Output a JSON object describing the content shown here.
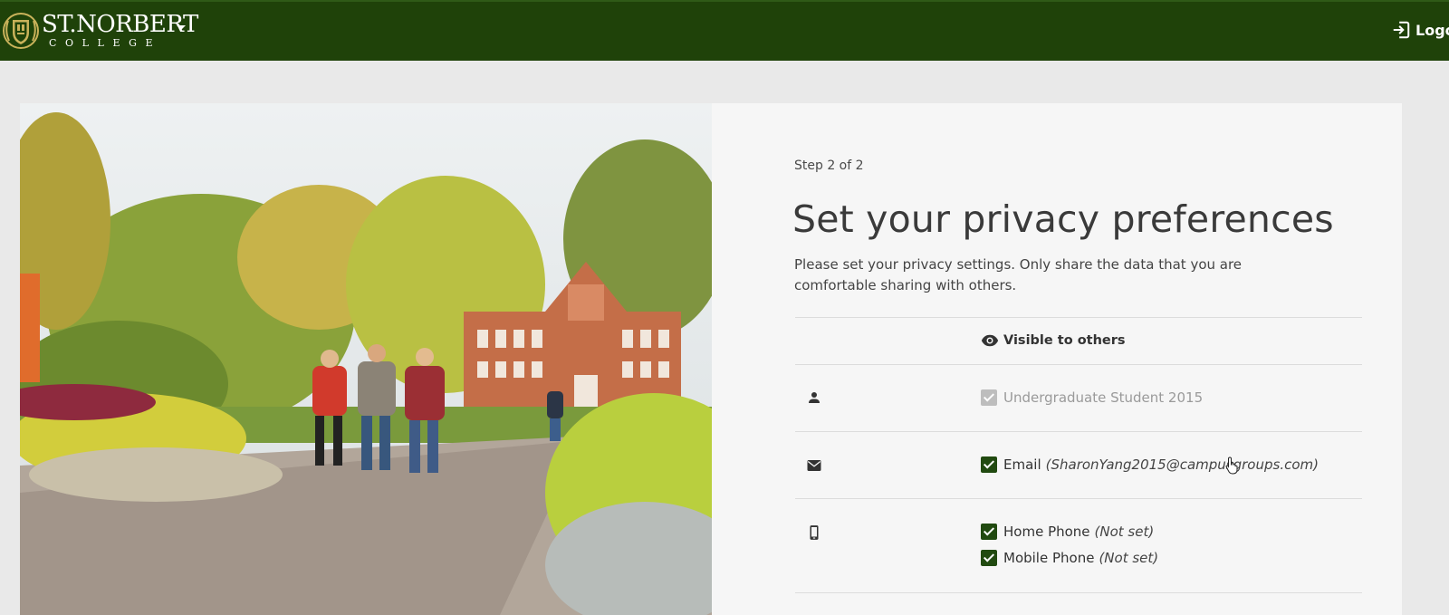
{
  "header": {
    "brand_top": "ST.NORBERT",
    "brand_bottom": "COLLEGE",
    "logout_label": "Logo",
    "colors": {
      "bar": "#1f4209",
      "accent": "#214a10"
    }
  },
  "icons": {
    "logout": "logout-icon",
    "visibility": "eye-icon",
    "user": "person-icon",
    "email": "envelope-icon",
    "phone": "mobile-phone-icon"
  },
  "privacy": {
    "step": "Step 2 of 2",
    "title": "Set your privacy preferences",
    "description": "Please set your privacy settings. Only share the data that you are comfortable sharing with others.",
    "column_header": "Visible to others",
    "options": {
      "student": {
        "label": "Undergraduate Student 2015",
        "checked": true,
        "disabled": true
      },
      "email": {
        "label": "Email",
        "value": "(SharonYang2015@campusgroups.com)",
        "checked": true
      },
      "home_phone": {
        "label": "Home Phone",
        "value": "(Not set)",
        "checked": true
      },
      "mobile_phone": {
        "label": "Mobile Phone",
        "value": "(Not set)",
        "checked": true
      }
    }
  }
}
